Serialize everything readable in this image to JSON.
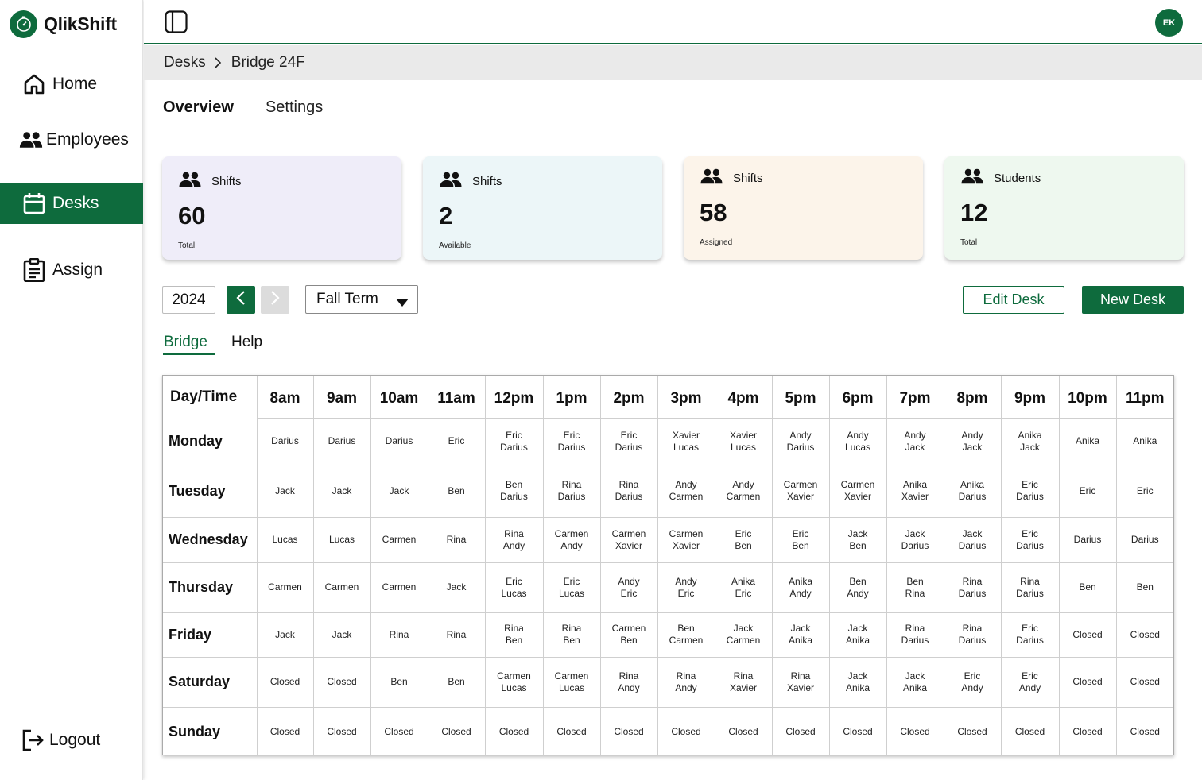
{
  "app": {
    "name": "QlikShift"
  },
  "sidebar": {
    "items": [
      {
        "label": "Home",
        "icon": "home-icon"
      },
      {
        "label": "Employees",
        "icon": "people-icon"
      },
      {
        "label": "Desks",
        "icon": "calendar-icon"
      },
      {
        "label": "Assign",
        "icon": "clipboard-icon"
      }
    ],
    "active": "Desks",
    "logout_label": "Logout"
  },
  "topbar": {
    "avatar_initials": "EK"
  },
  "breadcrumb": {
    "root": "Desks",
    "current": "Bridge 24F"
  },
  "page_tabs": [
    {
      "label": "Overview",
      "active": true
    },
    {
      "label": "Settings",
      "active": false
    }
  ],
  "cards": [
    {
      "title": "Shifts",
      "value": "60",
      "sub": "Total",
      "bg": "#efedf9"
    },
    {
      "title": "Shifts",
      "value": "2",
      "sub": "Available",
      "bg": "#ecf6f8"
    },
    {
      "title": "Shifts",
      "value": "58",
      "sub": "Assigned",
      "bg": "#fcf4ea"
    },
    {
      "title": "Students",
      "value": "12",
      "sub": "Total",
      "bg": "#eef8ef"
    }
  ],
  "controls": {
    "year": "2024",
    "term": "Fall Term",
    "edit_label": "Edit Desk",
    "new_label": "New Desk"
  },
  "sub_tabs": [
    {
      "label": "Bridge",
      "active": true
    },
    {
      "label": "Help",
      "active": false
    }
  ],
  "schedule": {
    "corner": "Day/Time",
    "times": [
      "8am",
      "9am",
      "10am",
      "11am",
      "12pm",
      "1pm",
      "2pm",
      "3pm",
      "4pm",
      "5pm",
      "6pm",
      "7pm",
      "8pm",
      "9pm",
      "10pm",
      "11pm"
    ],
    "rows": [
      {
        "day": "Monday",
        "cells": [
          "Darius",
          "Darius",
          "Darius",
          "Eric",
          "Eric\nDarius",
          "Eric\nDarius",
          "Eric\nDarius",
          "Xavier\nLucas",
          "Xavier\nLucas",
          "Andy\nDarius",
          "Andy\nLucas",
          "Andy\nJack",
          "Andy\nJack",
          "Anika\nJack",
          "Anika",
          "Anika"
        ]
      },
      {
        "day": "Tuesday",
        "cells": [
          "Jack",
          "Jack",
          "Jack",
          "Ben",
          "Ben\nDarius",
          "Rina\nDarius",
          "Rina\nDarius",
          "Andy\nCarmen",
          "Andy\nCarmen",
          "Carmen\nXavier",
          "Carmen\nXavier",
          "Anika\nXavier",
          "Anika\nDarius",
          "Eric\nDarius",
          "Eric",
          "Eric"
        ]
      },
      {
        "day": "Wednesday",
        "cells": [
          "Lucas",
          "Lucas",
          "Carmen",
          "Rina",
          "Rina\nAndy",
          "Carmen\nAndy",
          "Carmen\nXavier",
          "Carmen\nXavier",
          "Eric\nBen",
          "Eric\nBen",
          "Jack\nBen",
          "Jack\nDarius",
          "Jack\nDarius",
          "Eric\nDarius",
          "Darius",
          "Darius"
        ]
      },
      {
        "day": "Thursday",
        "cells": [
          "Carmen",
          "Carmen",
          "Carmen",
          "Jack",
          "Eric\nLucas",
          "Eric\nLucas",
          "Andy\nEric",
          "Andy\nEric",
          "Anika\nEric",
          "Anika\nAndy",
          "Ben\nAndy",
          "Ben\nRina",
          "Rina\nDarius",
          "Rina\nDarius",
          "Ben",
          "Ben"
        ]
      },
      {
        "day": "Friday",
        "cells": [
          "Jack",
          "Jack",
          "Rina",
          "Rina",
          "Rina\nBen",
          "Rina\nBen",
          "Carmen\nBen",
          "Ben\nCarmen",
          "Jack\nCarmen",
          "Jack\nAnika",
          "Jack\nAnika",
          "Rina\nDarius",
          "Rina\nDarius",
          "Eric\nDarius",
          "Closed",
          "Closed"
        ]
      },
      {
        "day": "Saturday",
        "cells": [
          "Closed",
          "Closed",
          "Ben",
          "Ben",
          "Carmen\nLucas",
          "Carmen\nLucas",
          "Rina\nAndy",
          "Rina\nAndy",
          "Rina\nXavier",
          "Rina\nXavier",
          "Jack\nAnika",
          "Jack\nAnika",
          "Eric\nAndy",
          "Eric\nAndy",
          "Closed",
          "Closed"
        ]
      },
      {
        "day": "Sunday",
        "cells": [
          "Closed",
          "Closed",
          "Closed",
          "Closed",
          "Closed",
          "Closed",
          "Closed",
          "Closed",
          "Closed",
          "Closed",
          "Closed",
          "Closed",
          "Closed",
          "Closed",
          "Closed",
          "Closed"
        ]
      }
    ]
  },
  "colors": {
    "brand": "#0e6b3d"
  }
}
